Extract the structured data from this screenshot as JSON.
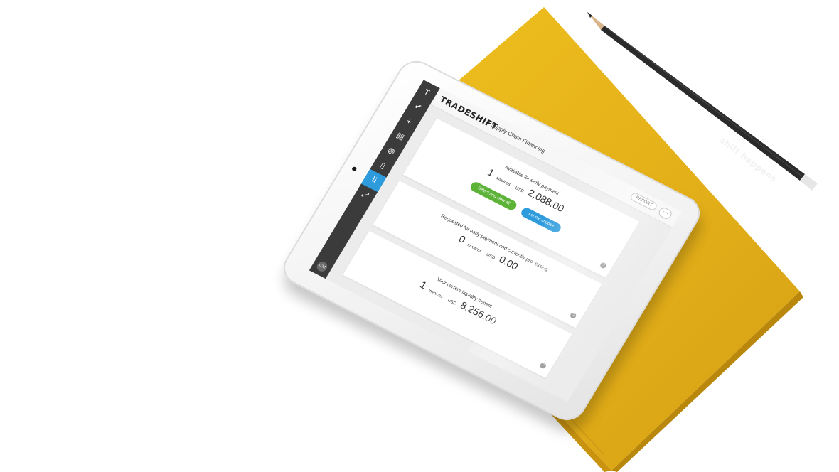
{
  "colors": {
    "notebook": "#e5b21a",
    "notebook_edge": "#c9930f",
    "pencil_body": "#2b2b2b",
    "tablet_frame": "#f2f2f2",
    "sidebar": "#3b3b3b",
    "accent_blue": "#2d9bdc",
    "accent_green": "#5cb338"
  },
  "pencil": {
    "text": "shift happens"
  },
  "app": {
    "logo": "TRADESHIFT",
    "title": "Supply Chain Financing",
    "report_label": "REPORT",
    "more_label": "···",
    "avatar_initials": "CM"
  },
  "sidebar": {
    "icons": [
      {
        "name": "tradeshift-logo-icon",
        "glyph": "T"
      },
      {
        "name": "checkmark-icon",
        "glyph": "✔"
      },
      {
        "name": "plus-icon",
        "glyph": "+"
      },
      {
        "name": "documents-icon",
        "glyph": "▤"
      },
      {
        "name": "globe-icon",
        "glyph": "◍"
      },
      {
        "name": "file-icon",
        "glyph": "▯"
      },
      {
        "name": "apps-grid-icon",
        "glyph": "⠿",
        "active": true
      },
      {
        "name": "expand-icon",
        "glyph": "⤢"
      }
    ]
  },
  "cards": [
    {
      "title": "Available for early payment",
      "count": "1",
      "unit": "invoices",
      "currency": "USD",
      "amount": "2,088.00",
      "buttons": [
        {
          "label": "Select and view all",
          "style": "green"
        },
        {
          "label": "Let me choose",
          "style": "blue"
        }
      ]
    },
    {
      "title": "Requested for early payment and currently processing",
      "count": "0",
      "unit": "invoices",
      "currency": "USD",
      "amount": "0.00"
    },
    {
      "title": "Your current liquidity benefit",
      "count": "1",
      "unit": "invoices",
      "currency": "USD",
      "amount": "8,256.00"
    }
  ],
  "help_glyph": "?"
}
